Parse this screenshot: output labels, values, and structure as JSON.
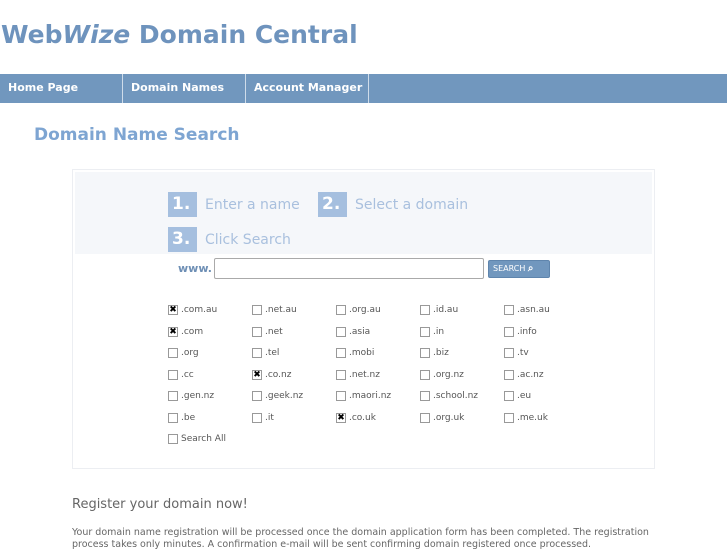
{
  "header": {
    "title_a": "Web",
    "title_b": "Wize",
    "title_c": " Domain Central"
  },
  "nav": [
    "Home Page",
    "Domain Names",
    "Account Manager"
  ],
  "page_title": "Domain Name Search",
  "steps": [
    {
      "num": "1.",
      "label": "Enter a name"
    },
    {
      "num": "2.",
      "label": "Select a domain"
    },
    {
      "num": "3.",
      "label": "Click Search"
    }
  ],
  "search": {
    "prefix": "www.",
    "value": "",
    "button": "SEARCH"
  },
  "domains": [
    {
      "label": ".com.au",
      "checked": true
    },
    {
      "label": ".net.au",
      "checked": false
    },
    {
      "label": ".org.au",
      "checked": false
    },
    {
      "label": ".id.au",
      "checked": false
    },
    {
      "label": ".asn.au",
      "checked": false
    },
    {
      "label": ".com",
      "checked": true
    },
    {
      "label": ".net",
      "checked": false
    },
    {
      "label": ".asia",
      "checked": false
    },
    {
      "label": ".in",
      "checked": false
    },
    {
      "label": ".info",
      "checked": false
    },
    {
      "label": ".org",
      "checked": false
    },
    {
      "label": ".tel",
      "checked": false
    },
    {
      "label": ".mobi",
      "checked": false
    },
    {
      "label": ".biz",
      "checked": false
    },
    {
      "label": ".tv",
      "checked": false
    },
    {
      "label": ".cc",
      "checked": false
    },
    {
      "label": ".co.nz",
      "checked": true
    },
    {
      "label": ".net.nz",
      "checked": false
    },
    {
      "label": ".org.nz",
      "checked": false
    },
    {
      "label": ".ac.nz",
      "checked": false
    },
    {
      "label": ".gen.nz",
      "checked": false
    },
    {
      "label": ".geek.nz",
      "checked": false
    },
    {
      "label": ".maori.nz",
      "checked": false
    },
    {
      "label": ".school.nz",
      "checked": false
    },
    {
      "label": ".eu",
      "checked": false
    },
    {
      "label": ".be",
      "checked": false
    },
    {
      "label": ".it",
      "checked": false
    },
    {
      "label": ".co.uk",
      "checked": true
    },
    {
      "label": ".org.uk",
      "checked": false
    },
    {
      "label": ".me.uk",
      "checked": false
    },
    {
      "label": "Search All",
      "checked": false
    }
  ],
  "register": {
    "heading": "Register your domain now!",
    "text": "Your domain name registration will be processed once the domain application form has been completed. The registration process takes only minutes. A confirmation e-mail will be sent confirming domain registered once processed."
  }
}
